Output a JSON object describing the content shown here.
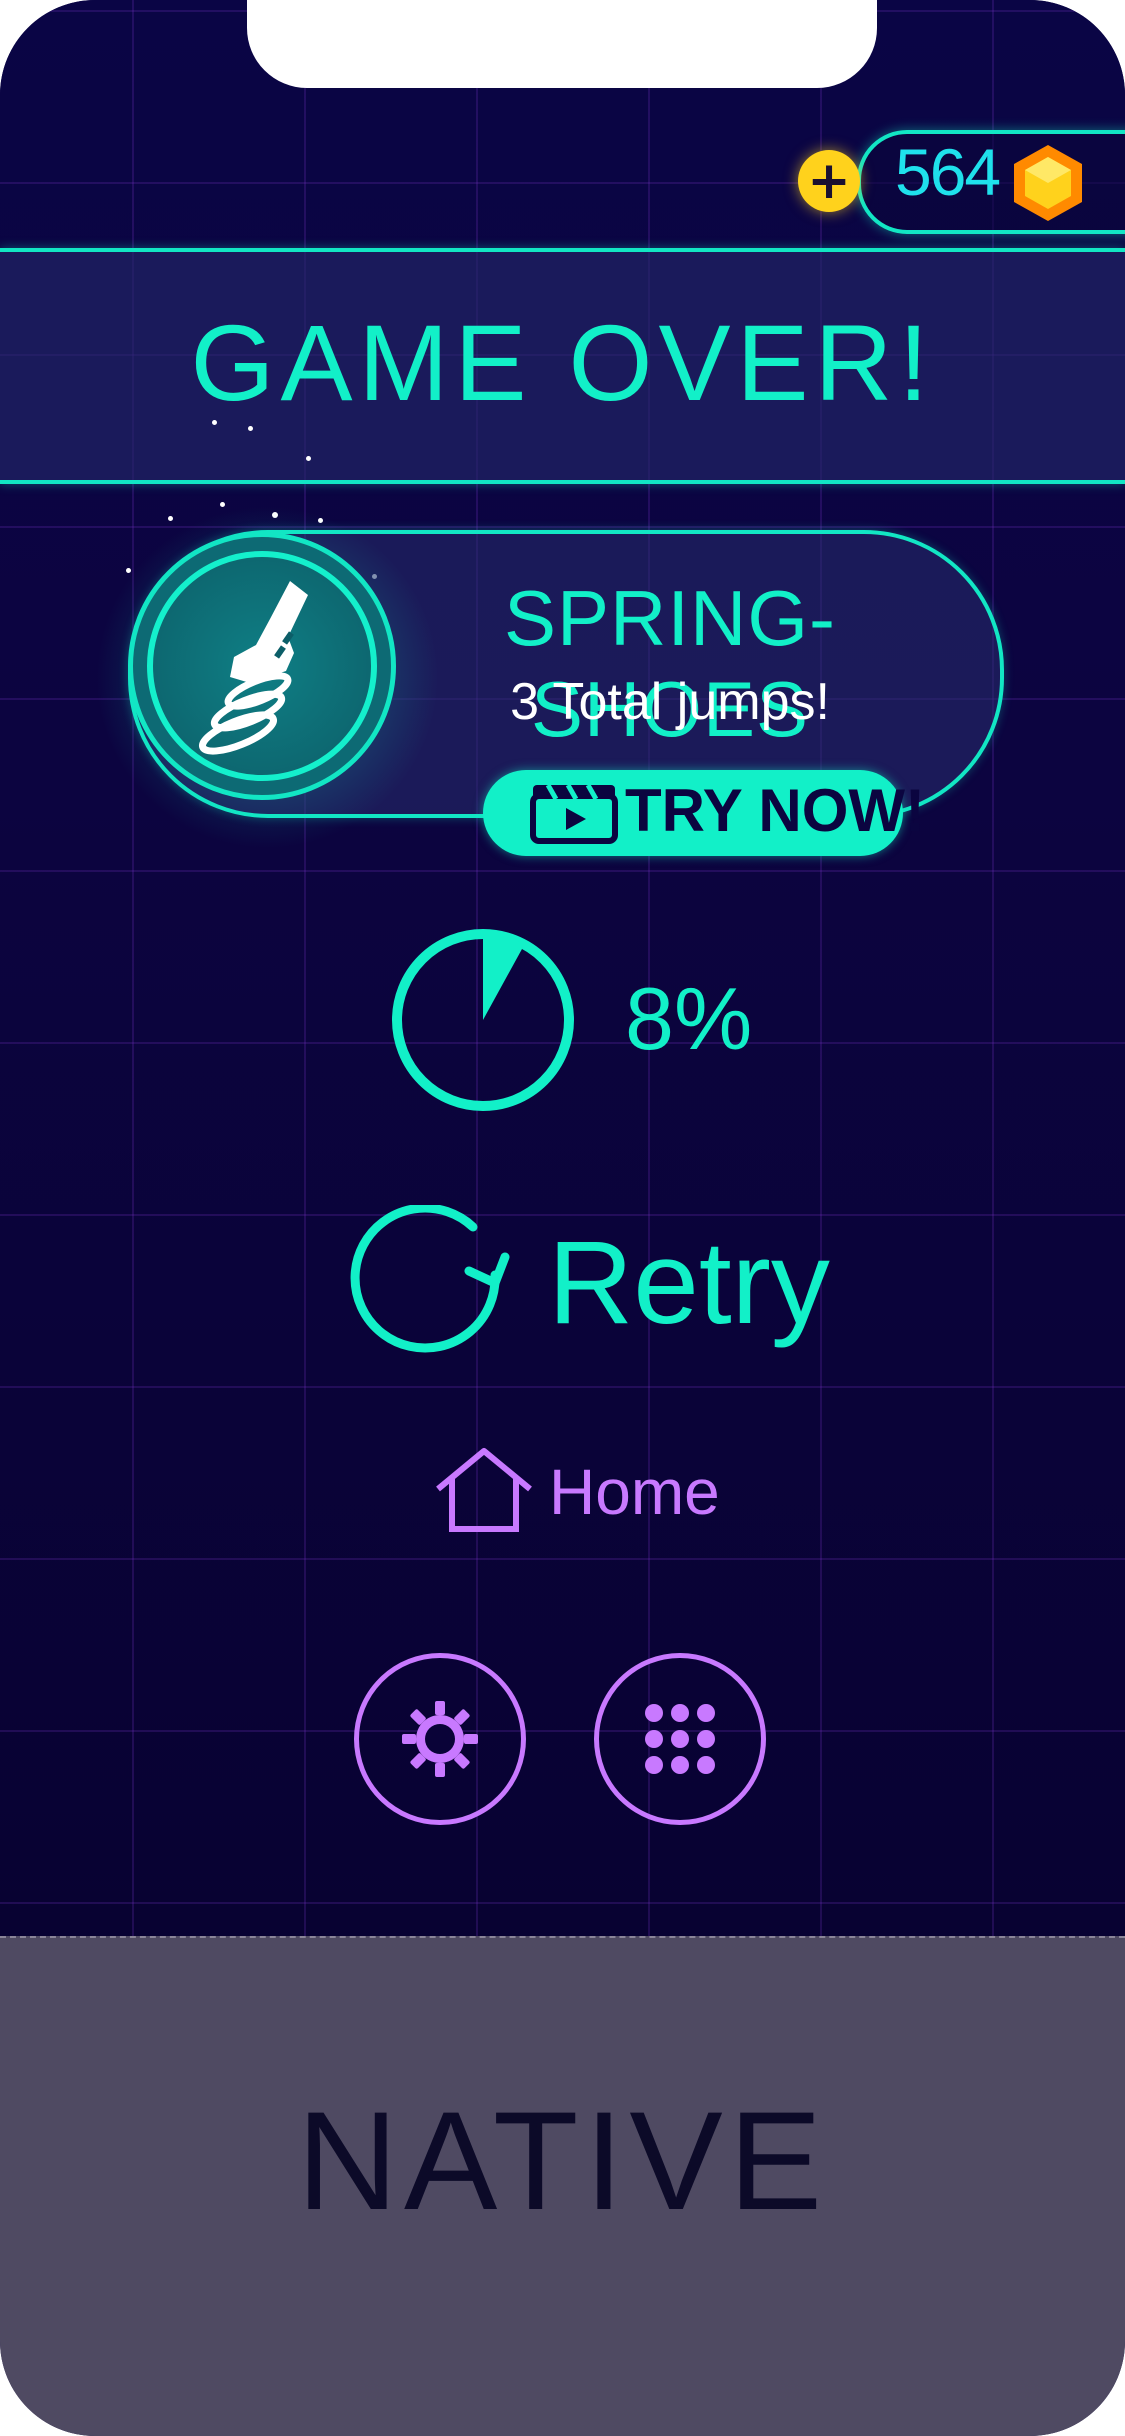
{
  "currency": {
    "plus_label": "+",
    "amount": "564",
    "icon": "gem-icon"
  },
  "banner": {
    "title": "GAME OVER!"
  },
  "powerup": {
    "name": "SPRING-SHOES",
    "description": "3 Total jumps!",
    "button_label": "TRY NOW!",
    "icon": "spring-shoe-icon"
  },
  "progress": {
    "value": 0.08,
    "label": "8%"
  },
  "actions": {
    "retry_label": "Retry",
    "home_label": "Home"
  },
  "buttons": {
    "settings_icon": "gear-icon",
    "menu_icon": "grid-icon"
  },
  "ad": {
    "label": "NATIVE"
  },
  "colors": {
    "accent": "#12f0c8",
    "secondary": "#c879ff",
    "background": "#0b0540",
    "coin": "#ffd21c"
  }
}
